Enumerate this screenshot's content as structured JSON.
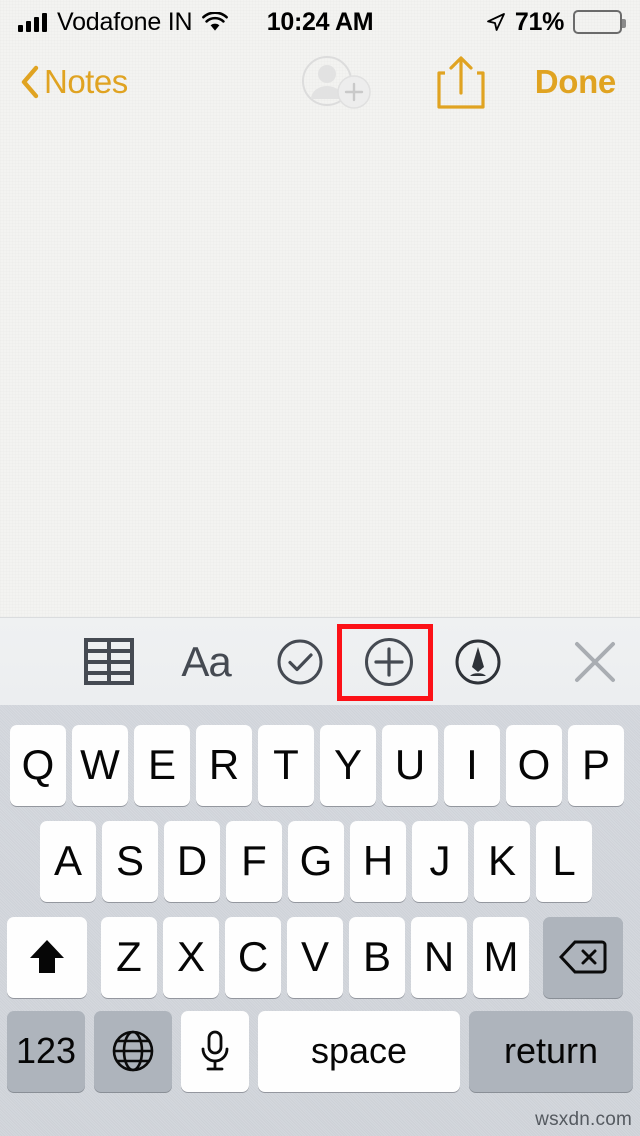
{
  "status_bar": {
    "carrier": "Vodafone IN",
    "time": "10:24 AM",
    "battery_percent": "71%",
    "signal_icon": "signal-bars-icon",
    "wifi_icon": "wifi-icon",
    "location_icon": "location-arrow-icon",
    "battery_icon": "battery-icon"
  },
  "nav_bar": {
    "back_label": "Notes",
    "back_icon": "chevron-left-icon",
    "add_person_icon": "add-person-icon",
    "share_icon": "share-icon",
    "done_label": "Done",
    "accent_color": "#e0a321"
  },
  "note": {
    "body_text": "",
    "placeholder": ""
  },
  "accessory_toolbar": {
    "items": [
      {
        "name": "table-icon",
        "label": "",
        "highlighted": false
      },
      {
        "name": "format-icon",
        "label": "Aa",
        "highlighted": false
      },
      {
        "name": "checklist-icon",
        "label": "",
        "highlighted": false
      },
      {
        "name": "add-attachment-icon",
        "label": "",
        "highlighted": true
      },
      {
        "name": "markup-pen-icon",
        "label": "",
        "highlighted": false
      },
      {
        "name": "close-icon",
        "label": "",
        "highlighted": false
      }
    ],
    "highlight_color": "#fc1117"
  },
  "keyboard": {
    "row1": [
      "Q",
      "W",
      "E",
      "R",
      "T",
      "Y",
      "U",
      "I",
      "O",
      "P"
    ],
    "row2": [
      "A",
      "S",
      "D",
      "F",
      "G",
      "H",
      "J",
      "K",
      "L"
    ],
    "row3_letters": [
      "Z",
      "X",
      "C",
      "V",
      "B",
      "N",
      "M"
    ],
    "shift_icon": "shift-icon",
    "backspace_icon": "backspace-icon",
    "numbers_label": "123",
    "globe_icon": "globe-icon",
    "dictation_icon": "microphone-icon",
    "space_label": "space",
    "return_label": "return"
  },
  "watermark": {
    "text": "wsxdn.com"
  }
}
